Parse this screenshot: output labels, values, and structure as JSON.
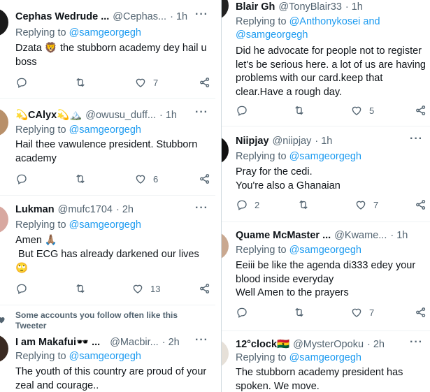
{
  "left_column": [
    {
      "name": "Cephas Wedrude ...",
      "handle": "@Cephas...",
      "time": "· 1h",
      "replying_prefix": "Replying to",
      "replying_to": "@samgeorgegh",
      "lines": [
        "Dzata 🦁 the stubborn academy dey hail u",
        "boss"
      ],
      "replies": "",
      "retweets": "",
      "likes": "7"
    },
    {
      "name": "💫CAlyx💫🏔️",
      "handle": "@owusu_duff...",
      "time": "· 1h",
      "replying_prefix": "Replying to",
      "replying_to": "@samgeorgegh",
      "lines": [
        "Hail thee vawulence president. Stubborn",
        "academy"
      ],
      "replies": "",
      "retweets": "",
      "likes": "6"
    },
    {
      "name": "Lukman",
      "handle": "@mufc1704",
      "time": "· 2h",
      "replying_prefix": "Replying to",
      "replying_to": "@samgeorgegh",
      "lines": [
        "Amen 🙏🏽",
        " But ECG has already darkened our lives",
        "🙄"
      ],
      "replies": "",
      "retweets": "",
      "likes": "13"
    },
    {
      "notice": [
        "Some accounts you follow often like this",
        "Tweeter"
      ],
      "name": "I am Makafui🕶️ ...",
      "handle": "@Macbir...",
      "time": "· 2h",
      "replying_prefix": "Replying to",
      "replying_to": "@samgeorgegh",
      "lines": [
        "The youth of this country are proud of your",
        "zeal and courage.."
      ]
    }
  ],
  "right_column": [
    {
      "name": "Blair Gh",
      "handle": "@TonyBlair33",
      "time": "· 1h",
      "replying_prefix": "Replying to",
      "replying_to": "@Anthonykosei and",
      "replying_to_2": "@samgeorgegh",
      "lines": [
        "Did he advocate for people not to register",
        "let's be serious here. a lot of us are having",
        "problems with our card.keep that",
        "clear.Have a rough day."
      ],
      "replies": "",
      "retweets": "",
      "likes": "5"
    },
    {
      "name": "Niipjay",
      "handle": "@niipjay",
      "time": "· 1h",
      "replying_prefix": "Replying to",
      "replying_to": "@samgeorgegh",
      "lines": [
        "Pray for the cedi.",
        "You're also a Ghanaian"
      ],
      "replies": "2",
      "retweets": "",
      "likes": "7"
    },
    {
      "name": "Quame McMaster ...",
      "handle": "@Kwame...",
      "time": "· 1h",
      "replying_prefix": "Replying to",
      "replying_to": "@samgeorgegh",
      "lines": [
        "Eeiii be like the agenda di333 edey your",
        "blood inside everyday",
        "Well Amen to the prayers"
      ],
      "replies": "",
      "retweets": "",
      "likes": "7"
    },
    {
      "name": "12°clock🇬🇭",
      "handle": "@MysterOpoku",
      "time": "· 2h",
      "replying_prefix": "Replying to",
      "replying_to": "@samgeorgegh",
      "lines": [
        "The stubborn academy president has",
        "spoken. We move."
      ]
    }
  ],
  "colors": {
    "link": "#1d9bf0",
    "muted": "#536471",
    "text": "#0f1419"
  }
}
